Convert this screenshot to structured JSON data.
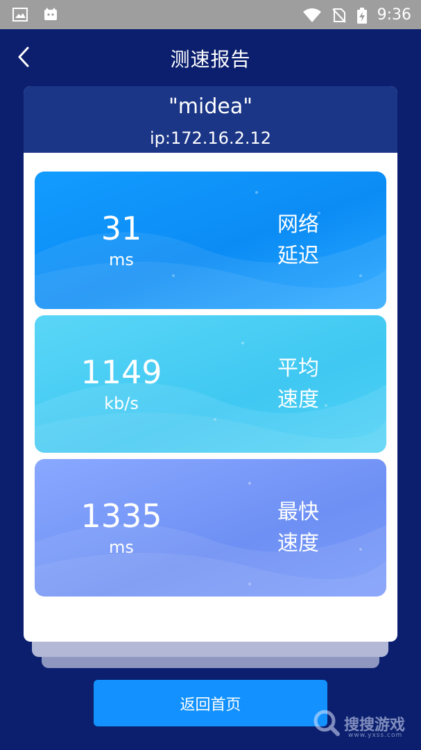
{
  "status_bar": {
    "time": "9:36",
    "icons": [
      "image-icon",
      "cat-icon",
      "wifi-icon",
      "no-sim-icon",
      "battery-charging-icon"
    ]
  },
  "header": {
    "title": "测速报告",
    "back_icon": "chevron-left-icon"
  },
  "network": {
    "ssid": "\"midea\"",
    "ip": "ip:172.16.2.12"
  },
  "metrics": [
    {
      "value": "31",
      "unit": "ms",
      "label_line1": "网络",
      "label_line2": "延迟",
      "color": "#139cff"
    },
    {
      "value": "1149",
      "unit": "kb/s",
      "label_line1": "平均",
      "label_line2": "速度",
      "color": "#4ccdf4"
    },
    {
      "value": "1335",
      "unit": "ms",
      "label_line1": "最快",
      "label_line2": "速度",
      "color": "#7c9bfa"
    }
  ],
  "footer": {
    "home_button_label": "返回首页"
  },
  "watermark": {
    "text": "搜搜游戏",
    "sub": "www.yxss.com"
  },
  "colors": {
    "background": "#0b1f6e",
    "card_header": "#1b3687",
    "button": "#1392ff"
  }
}
